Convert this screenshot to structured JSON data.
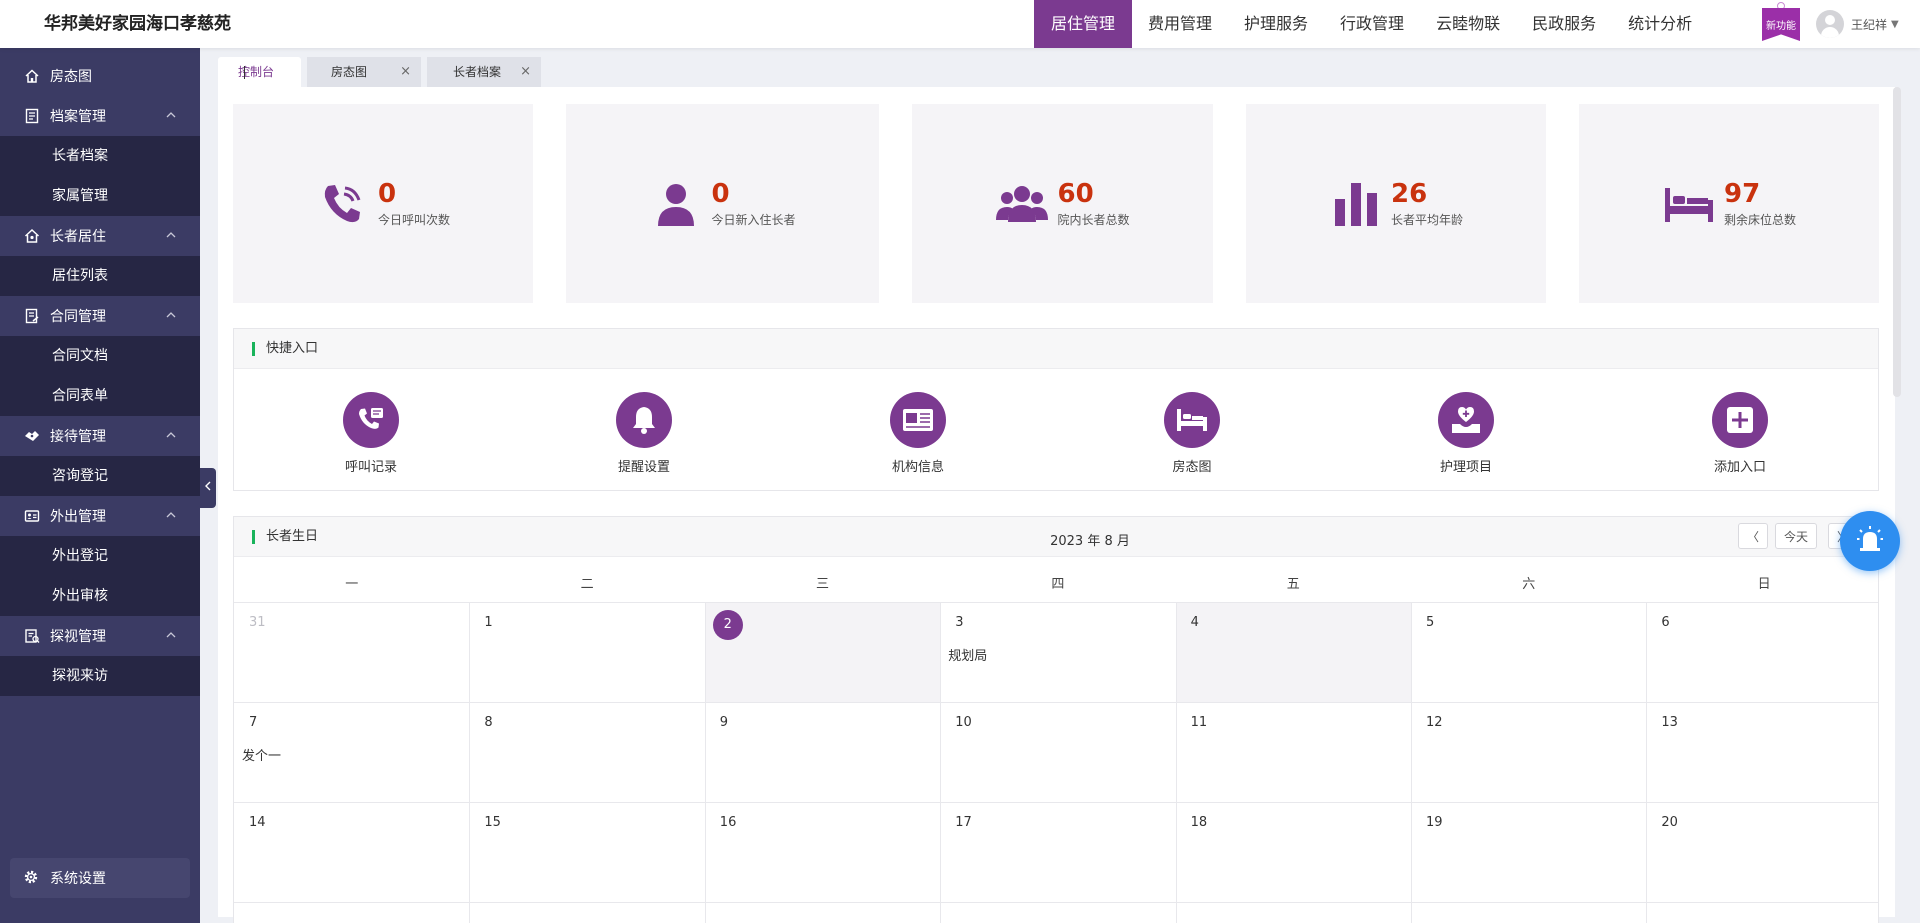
{
  "header": {
    "brand": "华邦美好家园海口孝慈苑",
    "nav": [
      "居住管理",
      "费用管理",
      "护理服务",
      "行政管理",
      "云睦物联",
      "民政服务",
      "统计分析"
    ],
    "active_nav": "居住管理",
    "new_feature_badge": "新功能",
    "user_name": "王纪祥",
    "accent_color": "#7b3a90"
  },
  "sidebar": {
    "items": [
      {
        "label": "房态图",
        "icon": "home-icon"
      },
      {
        "label": "档案管理",
        "icon": "archive-icon",
        "children": [
          "长者档案",
          "家属管理"
        ]
      },
      {
        "label": "长者居住",
        "icon": "house-icon",
        "children": [
          "居住列表"
        ]
      },
      {
        "label": "合同管理",
        "icon": "contract-icon",
        "children": [
          "合同文档",
          "合同表单"
        ]
      },
      {
        "label": "接待管理",
        "icon": "handshake-icon",
        "children": [
          "咨询登记"
        ]
      },
      {
        "label": "外出管理",
        "icon": "id-card-icon",
        "children": [
          "外出登记",
          "外出审核"
        ]
      },
      {
        "label": "探视管理",
        "icon": "visit-icon",
        "children": [
          "探视来访"
        ]
      }
    ],
    "settings_label": "系统设置"
  },
  "tabs": [
    {
      "label": "控制台",
      "closable": false
    },
    {
      "label": "房态图",
      "closable": true
    },
    {
      "label": "长者档案",
      "closable": true
    }
  ],
  "stats": [
    {
      "value": "0",
      "label": "今日呼叫次数",
      "icon": "phone-call-icon"
    },
    {
      "value": "0",
      "label": "今日新入住长者",
      "icon": "person-icon"
    },
    {
      "value": "60",
      "label": "院内长者总数",
      "icon": "group-icon"
    },
    {
      "value": "26",
      "label": "长者平均年龄",
      "icon": "bar-chart-icon"
    },
    {
      "value": "97",
      "label": "剩余床位总数",
      "icon": "bed-icon"
    }
  ],
  "quick_entry": {
    "title": "快捷入口",
    "items": [
      {
        "label": "呼叫记录",
        "icon": "call-record-icon"
      },
      {
        "label": "提醒设置",
        "icon": "bell-icon"
      },
      {
        "label": "机构信息",
        "icon": "info-card-icon"
      },
      {
        "label": "房态图",
        "icon": "bed-icon"
      },
      {
        "label": "护理项目",
        "icon": "care-icon"
      },
      {
        "label": "添加入口",
        "icon": "plus-icon"
      }
    ]
  },
  "calendar": {
    "title": "长者生日",
    "month_label": "2023 年 8 月",
    "prev_label": "〈",
    "today_label": "今天",
    "next_label": "〉",
    "weekdays": [
      "一",
      "二",
      "三",
      "四",
      "五",
      "六",
      "日"
    ],
    "weeks": [
      [
        {
          "d": "31",
          "muted": true
        },
        {
          "d": "1"
        },
        {
          "d": "2",
          "today": true
        },
        {
          "d": "3",
          "event": "规划局"
        },
        {
          "d": "4",
          "shade": true
        },
        {
          "d": "5"
        },
        {
          "d": "6"
        }
      ],
      [
        {
          "d": "7",
          "event": "发个一"
        },
        {
          "d": "8"
        },
        {
          "d": "9"
        },
        {
          "d": "10"
        },
        {
          "d": "11"
        },
        {
          "d": "12"
        },
        {
          "d": "13"
        }
      ],
      [
        {
          "d": "14"
        },
        {
          "d": "15"
        },
        {
          "d": "16"
        },
        {
          "d": "17"
        },
        {
          "d": "18"
        },
        {
          "d": "19"
        },
        {
          "d": "20"
        }
      ]
    ]
  }
}
